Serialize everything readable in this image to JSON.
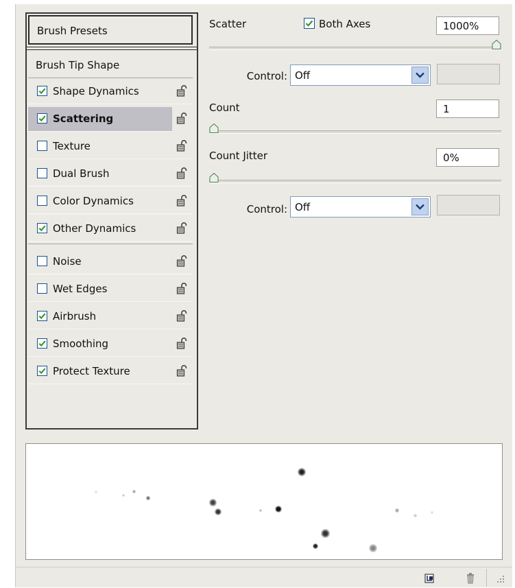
{
  "panel": {
    "brush_presets_label": "Brush Presets",
    "brush_tip_shape_label": "Brush Tip Shape",
    "items": [
      {
        "label": "Shape Dynamics",
        "checked": true,
        "selected": false
      },
      {
        "label": "Scattering",
        "checked": true,
        "selected": true
      },
      {
        "label": "Texture",
        "checked": false,
        "selected": false
      },
      {
        "label": "Dual Brush",
        "checked": false,
        "selected": false
      },
      {
        "label": "Color Dynamics",
        "checked": false,
        "selected": false
      },
      {
        "label": "Other Dynamics",
        "checked": true,
        "selected": false
      },
      {
        "label": "Noise",
        "checked": false,
        "selected": false
      },
      {
        "label": "Wet Edges",
        "checked": false,
        "selected": false
      },
      {
        "label": "Airbrush",
        "checked": true,
        "selected": false
      },
      {
        "label": "Smoothing",
        "checked": true,
        "selected": false
      },
      {
        "label": "Protect Texture",
        "checked": true,
        "selected": false
      }
    ],
    "lock_icon": "unlocked-padlock-icon"
  },
  "scatter": {
    "label": "Scatter",
    "both_axes_label": "Both Axes",
    "both_axes_checked": true,
    "value": "1000%",
    "slider_fraction": 1.0,
    "control_label": "Control:",
    "control_value": "Off"
  },
  "count": {
    "label": "Count",
    "value": "1",
    "slider_fraction": 0.0
  },
  "count_jitter": {
    "label": "Count Jitter",
    "value": "0%",
    "slider_fraction": 0.0,
    "control_label": "Control:",
    "control_value": "Off"
  },
  "bottom_icons": [
    "new-preset-icon",
    "trash-icon",
    "resize-grip-icon"
  ],
  "colors": {
    "panel_bg": "#ebeae4",
    "selection_bg": "#c0bfc6",
    "check": "#2e9a2e"
  }
}
